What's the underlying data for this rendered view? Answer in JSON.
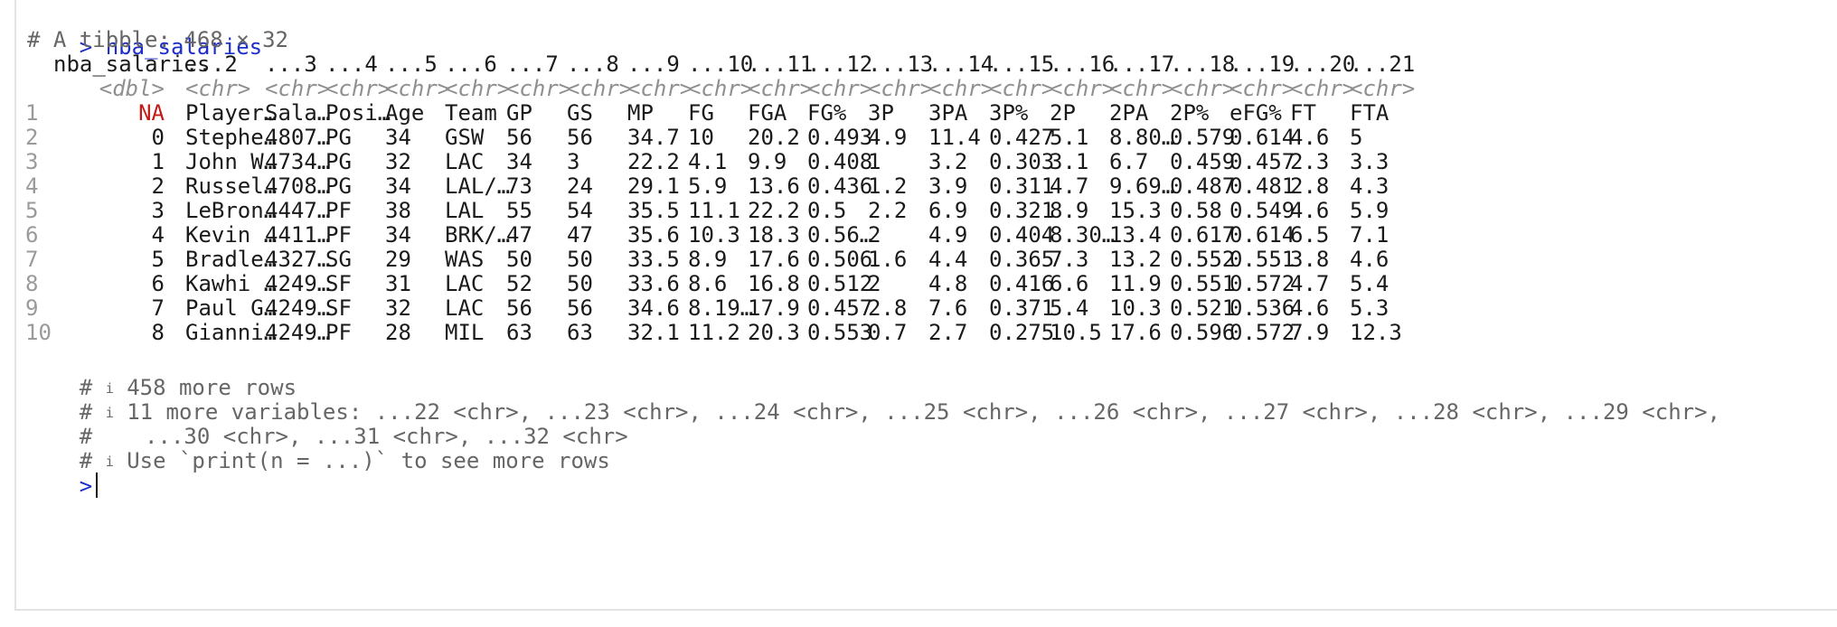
{
  "console": {
    "prompt": ">",
    "command": "nba_salaries",
    "tibble_header": "# A tibble: 468 × 32",
    "column_names": [
      "nba_salaries",
      "...2",
      "...3",
      "...4",
      "...5",
      "...6",
      "...7",
      "...8",
      "...9",
      "...10",
      "...11",
      "...12",
      "...13",
      "...14",
      "...15",
      "...16",
      "...17",
      "...18",
      "...19",
      "...20",
      "...21"
    ],
    "column_types": [
      "<dbl>",
      "<chr>",
      "<chr>",
      "<chr>",
      "<chr>",
      "<chr>",
      "<chr>",
      "<chr>",
      "<chr>",
      "<chr>",
      "<chr>",
      "<chr>",
      "<chr>",
      "<chr>",
      "<chr>",
      "<chr>",
      "<chr>",
      "<chr>",
      "<chr>",
      "<chr>",
      "<chr>"
    ],
    "rows": [
      {
        "num": "1",
        "cells": [
          "NA",
          "Player…",
          "Sala…",
          "Posi…",
          "Age",
          "Team",
          "GP",
          "GS",
          "MP",
          "FG",
          "FGA",
          "FG%",
          "3P",
          "3PA",
          "3P%",
          "2P",
          "2PA",
          "2P%",
          "eFG%",
          "FT",
          "FTA"
        ]
      },
      {
        "num": "2",
        "cells": [
          "0",
          "Stephe…",
          "4807…",
          "PG",
          "34",
          "GSW",
          "56",
          "56",
          "34.7",
          "10",
          "20.2",
          "0.493",
          "4.9",
          "11.4",
          "0.427",
          "5.1",
          "8.80…",
          "0.579",
          "0.614",
          "4.6",
          "5"
        ]
      },
      {
        "num": "3",
        "cells": [
          "1",
          "John W…",
          "4734…",
          "PG",
          "32",
          "LAC",
          "34",
          "3",
          "22.2",
          "4.1",
          "9.9",
          "0.408",
          "1",
          "3.2",
          "0.303",
          "3.1",
          "6.7",
          "0.459",
          "0.457",
          "2.3",
          "3.3"
        ]
      },
      {
        "num": "4",
        "cells": [
          "2",
          "Russel…",
          "4708…",
          "PG",
          "34",
          "LAL/…",
          "73",
          "24",
          "29.1",
          "5.9",
          "13.6",
          "0.436",
          "1.2",
          "3.9",
          "0.311",
          "4.7",
          "9.69…",
          "0.487",
          "0.481",
          "2.8",
          "4.3"
        ]
      },
      {
        "num": "5",
        "cells": [
          "3",
          "LeBron…",
          "4447…",
          "PF",
          "38",
          "LAL",
          "55",
          "54",
          "35.5",
          "11.1",
          "22.2",
          "0.5",
          "2.2",
          "6.9",
          "0.321",
          "8.9",
          "15.3",
          "0.58",
          "0.549",
          "4.6",
          "5.9"
        ]
      },
      {
        "num": "6",
        "cells": [
          "4",
          "Kevin …",
          "4411…",
          "PF",
          "34",
          "BRK/…",
          "47",
          "47",
          "35.6",
          "10.3",
          "18.3",
          "0.56…",
          "2",
          "4.9",
          "0.404",
          "8.30…",
          "13.4",
          "0.617",
          "0.614",
          "6.5",
          "7.1"
        ]
      },
      {
        "num": "7",
        "cells": [
          "5",
          "Bradle…",
          "4327…",
          "SG",
          "29",
          "WAS",
          "50",
          "50",
          "33.5",
          "8.9",
          "17.6",
          "0.506",
          "1.6",
          "4.4",
          "0.365",
          "7.3",
          "13.2",
          "0.552",
          "0.551",
          "3.8",
          "4.6"
        ]
      },
      {
        "num": "8",
        "cells": [
          "6",
          "Kawhi …",
          "4249…",
          "SF",
          "31",
          "LAC",
          "52",
          "50",
          "33.6",
          "8.6",
          "16.8",
          "0.512",
          "2",
          "4.8",
          "0.416",
          "6.6",
          "11.9",
          "0.551",
          "0.572",
          "4.7",
          "5.4"
        ]
      },
      {
        "num": "9",
        "cells": [
          "7",
          "Paul G…",
          "4249…",
          "SF",
          "32",
          "LAC",
          "56",
          "56",
          "34.6",
          "8.19…",
          "17.9",
          "0.457",
          "2.8",
          "7.6",
          "0.371",
          "5.4",
          "10.3",
          "0.521",
          "0.536",
          "4.6",
          "5.3"
        ]
      },
      {
        "num": "10",
        "cells": [
          "8",
          "Gianni…",
          "4249…",
          "PF",
          "28",
          "MIL",
          "63",
          "63",
          "32.1",
          "11.2",
          "20.3",
          "0.553",
          "0.7",
          "2.7",
          "0.275",
          "10.5",
          "17.6",
          "0.596",
          "0.572",
          "7.9",
          "12.3"
        ]
      }
    ],
    "footer": {
      "more_rows": "458 more rows",
      "more_vars_1": "11 more variables: ...22 <chr>, ...23 <chr>, ...24 <chr>, ...25 <chr>, ...26 <chr>, ...27 <chr>, ...28 <chr>, ...29 <chr>,",
      "more_vars_2": "  ...30 <chr>, ...31 <chr>, ...32 <chr>",
      "hint": "Use `print(n = ...)` to see more rows",
      "hash": "#",
      "info_icon": "i"
    },
    "colors": {
      "prompt": "#1c2ec9",
      "na": "#c41a16",
      "comment": "#666666",
      "dtype": "#8f8f8f"
    }
  }
}
